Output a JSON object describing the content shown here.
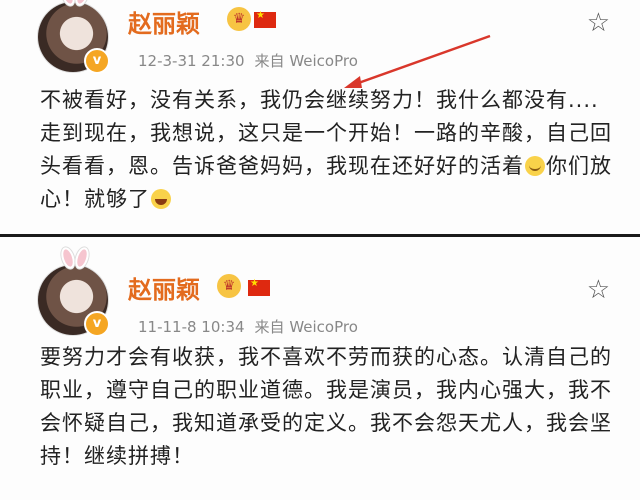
{
  "colors": {
    "username": "#e36b1e",
    "meta": "#888888",
    "text": "#222222",
    "annotation_arrow": "#d9372b"
  },
  "posts": [
    {
      "username": "赵丽颖",
      "timestamp": "12-3-31 21:30",
      "source": "来自 WeicoPro",
      "text_before": "不被看好，没有关系，我仍会继续努力！我什么都没有....走到现在，我想说，这只是一个开始！一路的辛酸，自己回头看看，恩。告诉爸爸妈妈，我现在还好好的活着",
      "text_middle": "你们放心！就够了",
      "emoji_1": "smile-emoji",
      "emoji_2": "laugh-emoji"
    },
    {
      "username": "赵丽颖",
      "timestamp": "11-11-8 10:34",
      "source": "来自 WeicoPro",
      "text": "要努力才会有收获，我不喜欢不劳而获的心态。认清自己的职业，遵守自己的职业道德。我是演员，我内心强大，我不会怀疑自己，我知道承受的定义。我不会怨天尤人，我会坚持！继续拼搏！"
    }
  ],
  "icons": {
    "favorite": "star-outline-icon",
    "crown": "crown-icon",
    "flag": "china-flag-icon",
    "verified": "verified-v-icon"
  },
  "badge": {
    "verified_letter": "v"
  }
}
